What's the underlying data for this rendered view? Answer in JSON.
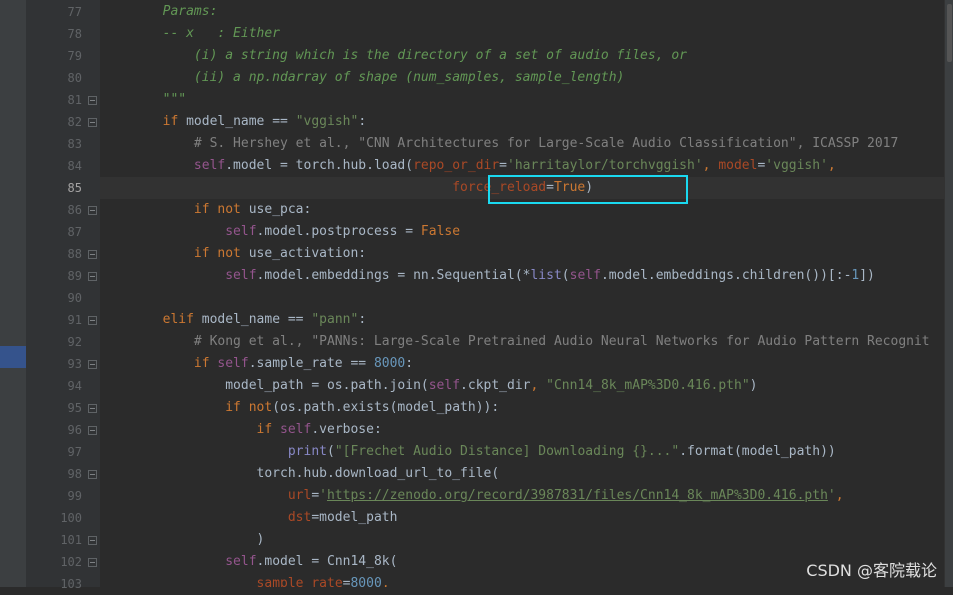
{
  "code_lines": [
    {
      "n": "77",
      "t": [
        [
          "doc",
          "        Params:"
        ]
      ]
    },
    {
      "n": "78",
      "t": [
        [
          "doc",
          "        -- x   : Either"
        ]
      ]
    },
    {
      "n": "79",
      "t": [
        [
          "doc",
          "            (i) a string which is the directory of a set of audio files, or"
        ]
      ]
    },
    {
      "n": "80",
      "t": [
        [
          "doc",
          "            (ii) a np.ndarray of shape (num_samples, sample_length)"
        ]
      ]
    },
    {
      "n": "81",
      "t": [
        [
          "doc",
          "        \"\"\""
        ]
      ],
      "fold": true
    },
    {
      "n": "82",
      "t": [
        [
          "",
          "        "
        ],
        [
          "kw",
          "if "
        ],
        [
          "",
          "model_name == "
        ],
        [
          "str",
          "\"vggish\""
        ],
        [
          "",
          ":"
        ]
      ],
      "fold": true
    },
    {
      "n": "83",
      "t": [
        [
          "cmt",
          "            # S. Hershey et al., \"CNN Architectures for Large-Scale Audio Classification\", ICASSP 2017"
        ]
      ]
    },
    {
      "n": "84",
      "t": [
        [
          "",
          "            "
        ],
        [
          "self",
          "self"
        ],
        [
          "",
          ".model = torch.hub.load("
        ],
        [
          "param",
          "repo_or_dir"
        ],
        [
          "",
          "="
        ],
        [
          "str",
          "'harritaylor/torchvggish'"
        ],
        [
          "kw",
          ", "
        ],
        [
          "param",
          "model"
        ],
        [
          "",
          "="
        ],
        [
          "str",
          "'vggish'"
        ],
        [
          "kw",
          ","
        ]
      ]
    },
    {
      "n": "85",
      "t": [
        [
          "",
          "                                             "
        ],
        [
          "param",
          "force_reload"
        ],
        [
          "",
          "="
        ],
        [
          "kw",
          "True"
        ],
        [
          "",
          ")"
        ]
      ],
      "current": true
    },
    {
      "n": "86",
      "t": [
        [
          "",
          "            "
        ],
        [
          "kw",
          "if not "
        ],
        [
          "",
          "use_pca:"
        ]
      ],
      "fold": true
    },
    {
      "n": "87",
      "t": [
        [
          "",
          "                "
        ],
        [
          "self",
          "self"
        ],
        [
          "",
          ".model.postprocess = "
        ],
        [
          "kw",
          "False"
        ]
      ]
    },
    {
      "n": "88",
      "t": [
        [
          "",
          "            "
        ],
        [
          "kw",
          "if not "
        ],
        [
          "",
          "use_activation:"
        ]
      ],
      "fold": true
    },
    {
      "n": "89",
      "t": [
        [
          "",
          "                "
        ],
        [
          "self",
          "self"
        ],
        [
          "",
          ".model.embeddings = nn.Sequential(*"
        ],
        [
          "bi",
          "list"
        ],
        [
          "",
          "("
        ],
        [
          "self",
          "self"
        ],
        [
          "",
          ".model.embeddings.children())[:-"
        ],
        [
          "num",
          "1"
        ],
        [
          "",
          "])"
        ]
      ],
      "fold": true
    },
    {
      "n": "90",
      "t": [
        [
          "",
          ""
        ]
      ]
    },
    {
      "n": "91",
      "t": [
        [
          "",
          "        "
        ],
        [
          "kw",
          "elif "
        ],
        [
          "",
          "model_name == "
        ],
        [
          "str",
          "\"pann\""
        ],
        [
          "",
          ":"
        ]
      ],
      "fold": true
    },
    {
      "n": "92",
      "t": [
        [
          "cmt",
          "            # Kong et al., \"PANNs: Large-Scale Pretrained Audio Neural Networks for Audio Pattern Recognit"
        ]
      ]
    },
    {
      "n": "93",
      "t": [
        [
          "",
          "            "
        ],
        [
          "kw",
          "if "
        ],
        [
          "self",
          "self"
        ],
        [
          "",
          ".sample_rate == "
        ],
        [
          "num",
          "8000"
        ],
        [
          "",
          ":"
        ]
      ],
      "fold": true
    },
    {
      "n": "94",
      "t": [
        [
          "",
          "                model_path = os.path.join("
        ],
        [
          "self",
          "self"
        ],
        [
          "",
          ".ckpt_dir"
        ],
        [
          "kw",
          ", "
        ],
        [
          "str",
          "\"Cnn14_8k_mAP%3D0.416.pth\""
        ],
        [
          "",
          ")"
        ]
      ]
    },
    {
      "n": "95",
      "t": [
        [
          "",
          "                "
        ],
        [
          "kw",
          "if not"
        ],
        [
          "",
          "(os.path.exists(model_path)):"
        ]
      ],
      "fold": true
    },
    {
      "n": "96",
      "t": [
        [
          "",
          "                    "
        ],
        [
          "kw",
          "if "
        ],
        [
          "self",
          "self"
        ],
        [
          "",
          ".verbose:"
        ]
      ],
      "fold": true
    },
    {
      "n": "97",
      "t": [
        [
          "",
          "                        "
        ],
        [
          "bi",
          "print"
        ],
        [
          "",
          "("
        ],
        [
          "str",
          "\"[Frechet Audio Distance] Downloading {}...\""
        ],
        [
          "",
          ".format(model_path))"
        ]
      ]
    },
    {
      "n": "98",
      "t": [
        [
          "",
          "                    torch.hub.download_url_to_file("
        ]
      ],
      "fold": true
    },
    {
      "n": "99",
      "t": [
        [
          "",
          "                        "
        ],
        [
          "param",
          "url"
        ],
        [
          "",
          "="
        ],
        [
          "str",
          "'"
        ],
        [
          "url",
          "https://zenodo.org/record/3987831/files/Cnn14_8k_mAP%3D0.416.pth"
        ],
        [
          "str",
          "'"
        ],
        [
          "kw",
          ","
        ]
      ]
    },
    {
      "n": "100",
      "t": [
        [
          "",
          "                        "
        ],
        [
          "param",
          "dst"
        ],
        [
          "",
          "=model_path"
        ]
      ]
    },
    {
      "n": "101",
      "t": [
        [
          "",
          "                    )"
        ]
      ],
      "fold": true
    },
    {
      "n": "102",
      "t": [
        [
          "",
          "                "
        ],
        [
          "self",
          "self"
        ],
        [
          "",
          ".model = Cnn14_8k("
        ]
      ],
      "fold": true
    },
    {
      "n": "103",
      "t": [
        [
          "",
          "                    "
        ],
        [
          "param",
          "sample_rate"
        ],
        [
          "",
          "="
        ],
        [
          "num",
          "8000"
        ],
        [
          "kw",
          ","
        ]
      ]
    }
  ],
  "watermark": "CSDN @客院载论"
}
